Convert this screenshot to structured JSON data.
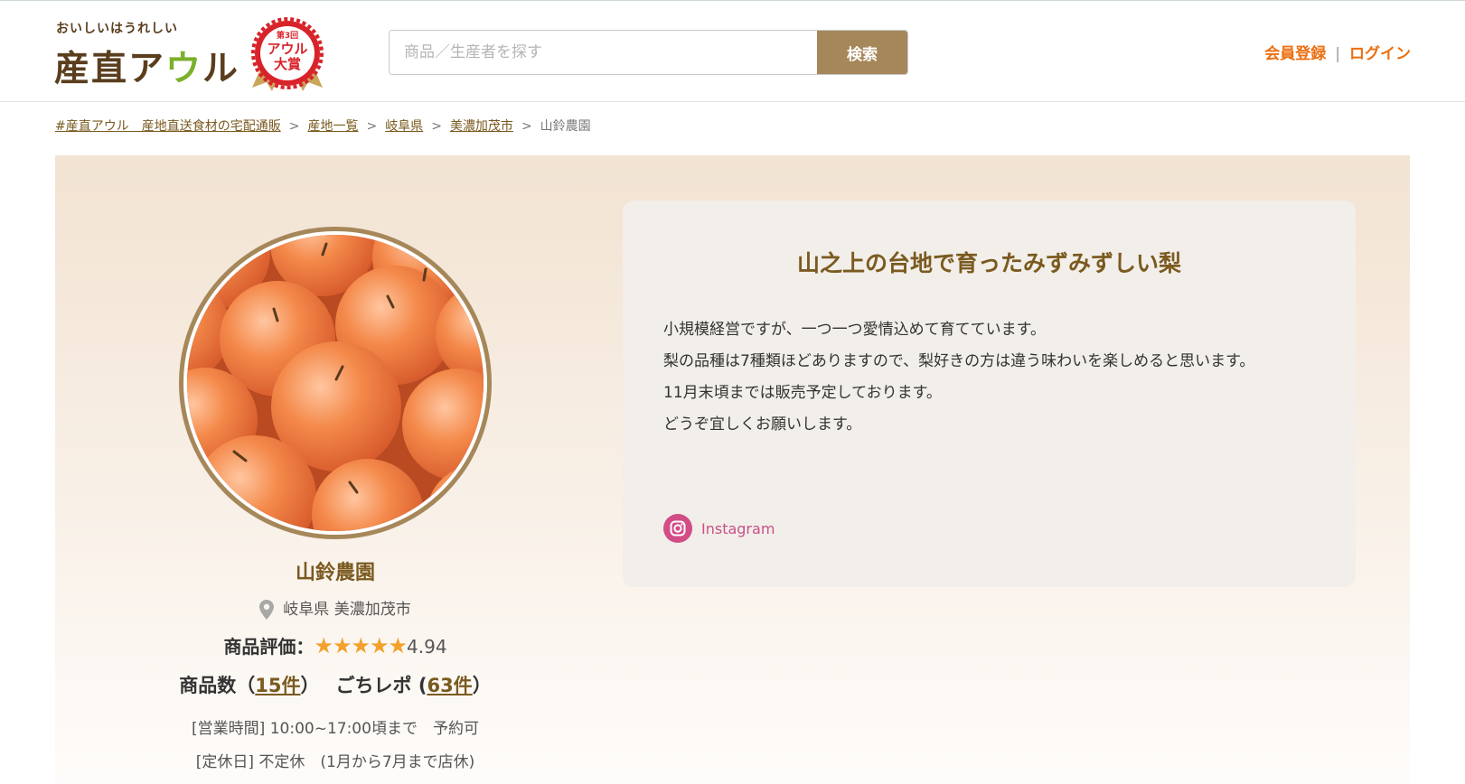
{
  "header": {
    "logo_tagline": "おいしいはうれしい",
    "logo_text_a": "産直ア",
    "logo_text_u": "ウ",
    "logo_text_b": "ル",
    "award_line1": "第3回",
    "award_line2": "アウル",
    "award_line3": "大賞",
    "search_placeholder": "商品／生産者を探す",
    "search_button": "検索",
    "signup_label": "会員登録",
    "auth_separator": "|",
    "login_label": "ログイン"
  },
  "breadcrumb": {
    "items": [
      "#産直アウル　産地直送食材の宅配通販",
      "産地一覧",
      "岐阜県",
      "美濃加茂市"
    ],
    "current": "山鈴農園",
    "separator": ">"
  },
  "profile": {
    "image_description": "pears-photo",
    "name": "山鈴農園",
    "location": "岐阜県 美濃加茂市",
    "rating_label": "商品評価：",
    "rating_stars": "★★★★★",
    "rating_value": "4.94",
    "product_count_prefix": "商品数（",
    "product_count": "15件",
    "product_count_suffix": "）",
    "report_prefix": "ごちレポ (",
    "report_count": "63件",
    "report_suffix": "）",
    "hours": "[営業時間] 10:00~17:00頃まで　予約可",
    "holiday": "[定休日] 不定休　(1月から7月まで店休)"
  },
  "intro": {
    "title": "山之上の台地で育ったみずみずしい梨",
    "lines": [
      "小規模経営ですが、一つ一つ愛情込めて育てています。",
      "梨の品種は7種類ほどありますので、梨好きの方は違う味わいを楽しめると思います。",
      "11月末頃までは販売予定しております。",
      "どうぞ宜しくお願いします。"
    ],
    "instagram_label": "Instagram"
  },
  "colors": {
    "brand_brown": "#7a5a1f",
    "button_tan": "#a6875a",
    "accent_orange": "#ec6f10",
    "star": "#f2a12c",
    "instagram_pink": "#d24c86"
  }
}
